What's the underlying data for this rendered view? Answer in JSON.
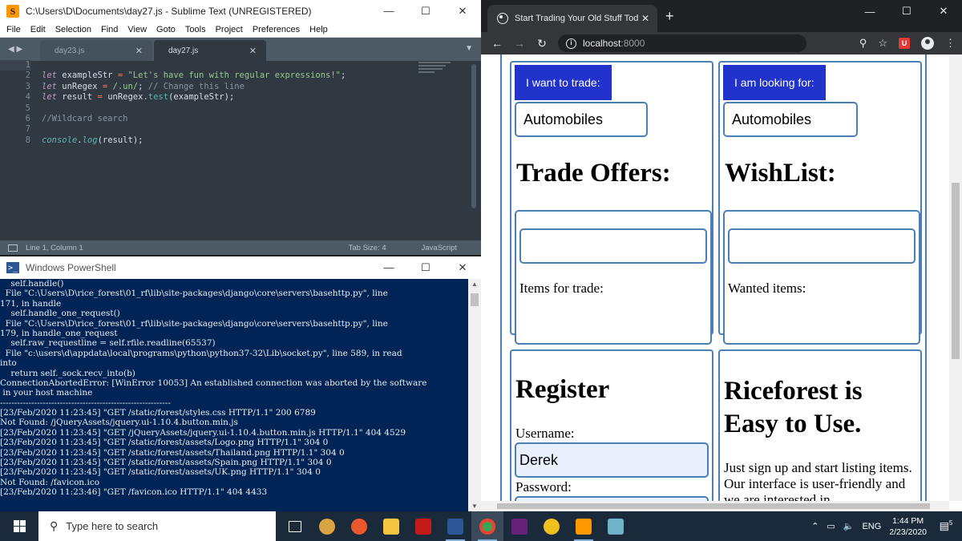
{
  "sublime": {
    "title": "C:\\Users\\D\\Documents\\day27.js - Sublime Text (UNREGISTERED)",
    "logo": "S",
    "menu": [
      "File",
      "Edit",
      "Selection",
      "Find",
      "View",
      "Goto",
      "Tools",
      "Project",
      "Preferences",
      "Help"
    ],
    "tabs": [
      {
        "label": "day23.js",
        "active": false
      },
      {
        "label": "day27.js",
        "active": true
      }
    ],
    "line_numbers": [
      "1",
      "2",
      "3",
      "4",
      "5",
      "6",
      "7",
      "8"
    ],
    "code": {
      "l2": {
        "kw": "let",
        "var": " exampleStr ",
        "op": "=",
        "str": " \"Let's have fun with regular expressions!\"",
        "end": ";"
      },
      "l3": {
        "kw": "let",
        "var": " unRegex ",
        "op": "=",
        "regex": " /.un/",
        "mid": "; ",
        "comment": "// Change this line"
      },
      "l4": {
        "kw": "let",
        "var": " result ",
        "op": "=",
        "pre": " unRegex.",
        "fn": "test",
        "post": "(exampleStr);"
      },
      "l6": {
        "comment": "//Wildcard search"
      },
      "l8": {
        "obj": "console",
        "dot": ".",
        "fn": "log",
        "post": "(result);"
      }
    },
    "status": {
      "position": "Line 1, Column 1",
      "tab_size": "Tab Size: 4",
      "syntax": "JavaScript"
    }
  },
  "powershell": {
    "title": "Windows PowerShell",
    "icon": ">_",
    "lines": [
      "    self.handle()",
      "  File \"C:\\Users\\D\\rice_forest\\01_rf\\lib\\site-packages\\django\\core\\servers\\basehttp.py\", line",
      "171, in handle",
      "    self.handle_one_request()",
      "  File \"C:\\Users\\D\\rice_forest\\01_rf\\lib\\site-packages\\django\\core\\servers\\basehttp.py\", line",
      "179, in handle_one_request",
      "    self.raw_requestline = self.rfile.readline(65537)",
      "  File \"c:\\users\\d\\appdata\\local\\programs\\python\\python37-32\\Lib\\socket.py\", line 589, in read",
      "into",
      "    return self._sock.recv_into(b)",
      "ConnectionAbortedError: [WinError 10053] An established connection was aborted by the software",
      " in your host machine",
      "------------------------------------------------------------",
      "[23/Feb/2020 11:23:45] \"GET /static/forest/styles.css HTTP/1.1\" 200 6789",
      "Not Found: /jQueryAssets/jquery.ui-1.10.4.button.min.js",
      "[23/Feb/2020 11:23:45] \"GET /jQueryAssets/jquery.ui-1.10.4.button.min.js HTTP/1.1\" 404 4529",
      "[23/Feb/2020 11:23:45] \"GET /static/forest/assets/Logo.png HTTP/1.1\" 304 0",
      "[23/Feb/2020 11:23:45] \"GET /static/forest/assets/Thailand.png HTTP/1.1\" 304 0",
      "[23/Feb/2020 11:23:45] \"GET /static/forest/assets/Spain.png HTTP/1.1\" 304 0",
      "[23/Feb/2020 11:23:45] \"GET /static/forest/assets/UK.png HTTP/1.1\" 304 0",
      "Not Found: /favicon.ico",
      "[23/Feb/2020 11:23:46] \"GET /favicon.ico HTTP/1.1\" 404 4433"
    ]
  },
  "chrome": {
    "tab_title": "Start Trading Your Old Stuff Toda",
    "url_host": "localhost",
    "url_port": ":8000",
    "ext_icon": "U",
    "page": {
      "trade_button": "I want to trade:",
      "trade_select": "Automobiles",
      "looking_button": "I am looking for:",
      "looking_select": "Automobiles",
      "trade_offers_heading": "Trade Offers:",
      "wishlist_heading": "WishList:",
      "items_for_trade_label": "Items for trade:",
      "wanted_items_label": "Wanted items:",
      "register_heading": "Register",
      "username_label": "Username:",
      "username_value": "Derek",
      "password_label": "Password:",
      "easy_heading": "Riceforest is Easy to Use.",
      "easy_text": "Just sign up and start listing items. Our interface is user-friendly and we are interested in"
    }
  },
  "taskbar": {
    "search_placeholder": "Type here to search",
    "tray_lang": "ENG",
    "time": "1:44 PM",
    "date": "2/23/2020",
    "notification_count": "5"
  }
}
